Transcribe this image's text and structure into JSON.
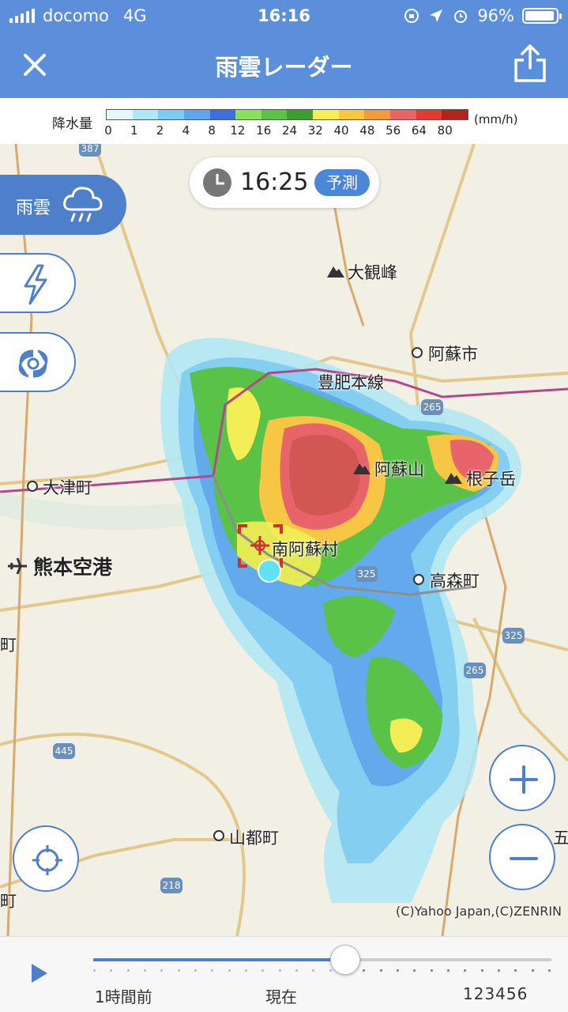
{
  "status_bar": {
    "carrier": "docomo",
    "network": "4G",
    "time": "16:16",
    "battery": "96%",
    "battery_level": 0.96
  },
  "header": {
    "title": "雨雲レーダー",
    "close_icon": "close-icon",
    "share_icon": "share-icon",
    "color": "#5b8fdc"
  },
  "legend": {
    "label": "降水量",
    "unit": "(mm/h)",
    "ticks": [
      "0",
      "1",
      "2",
      "4",
      "8",
      "12",
      "16",
      "24",
      "32",
      "40",
      "48",
      "56",
      "64",
      "80"
    ],
    "colors": [
      "#e4f8fb",
      "#aee8f5",
      "#7ecbf2",
      "#5ea6ea",
      "#3e6fe0",
      "#88e05e",
      "#5ac246",
      "#3e9e32",
      "#f3ee55",
      "#f6c644",
      "#ef9a3c",
      "#e8646a",
      "#e33b2e",
      "#b2231e"
    ]
  },
  "map": {
    "time_display": "16:25",
    "forecast_badge": "予測",
    "layers": {
      "rain_label": "雨雲",
      "rain_icon": "rain-cloud-icon",
      "lightning_icon": "lightning-icon",
      "typhoon_icon": "typhoon-icon"
    },
    "places": {
      "daikanbo": "大観峰",
      "aso_city": "阿蘇市",
      "hohi_line": "豊肥本線",
      "aso_san": "阿蘇山",
      "nekodake": "根子岳",
      "ozu_town": "大津町",
      "minamiaso": "南阿蘇村",
      "kumamoto_airport": "熊本空港",
      "takamori": "高森町",
      "yamato": "山都町",
      "edge_cho": "町",
      "edge_cho2": "町",
      "edge_go": "五"
    },
    "roads": {
      "r387": "387",
      "r265a": "265",
      "r325a": "325",
      "r325b": "325",
      "r265b": "265",
      "r445": "445",
      "r218": "218"
    },
    "zoom_in_icon": "plus-icon",
    "zoom_out_icon": "minus-icon",
    "locate_icon": "crosshair-icon",
    "copyright": "(C)Yahoo Japan,(C)ZENRIN"
  },
  "timeline": {
    "play_icon": "play-icon",
    "label_past": "1時間前",
    "label_now": "現在",
    "label_future": "123456",
    "position": 0.55
  }
}
